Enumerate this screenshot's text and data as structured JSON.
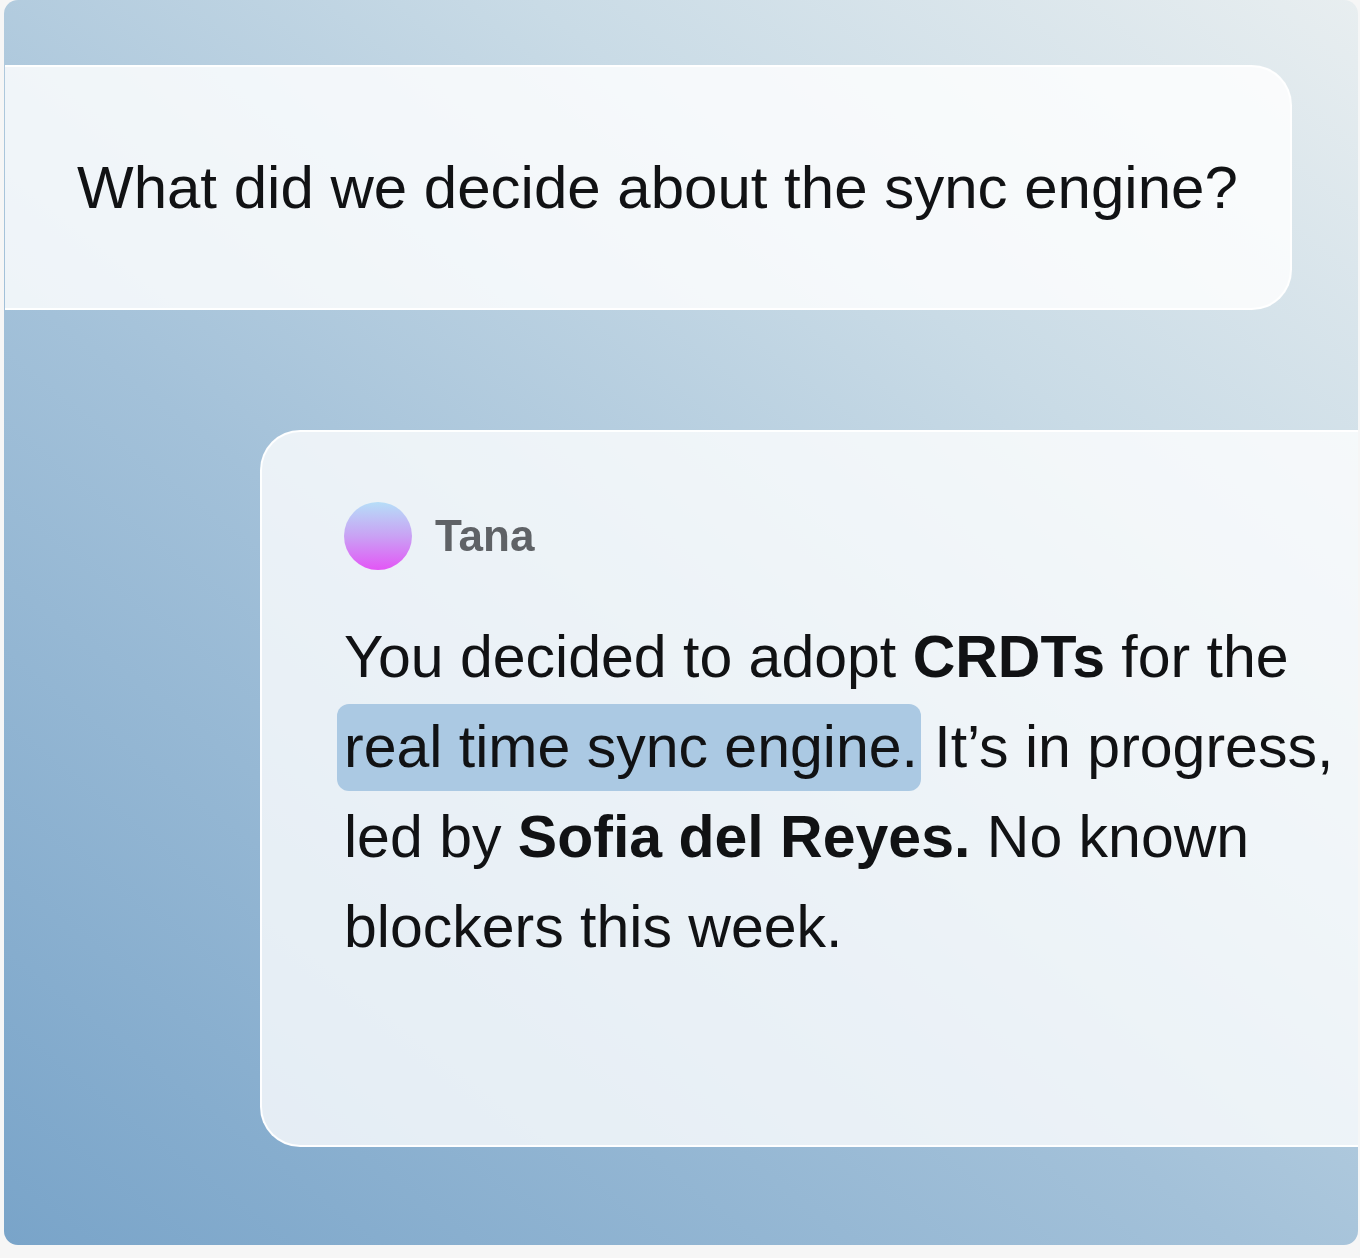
{
  "question": {
    "text": "What did we decide about the sync engine?"
  },
  "answer": {
    "sender": "Tana",
    "segments": [
      {
        "text": "You decided to adopt **CRDTs** for the ",
        "highlighted": false
      },
      {
        "text": "real time sync engine.",
        "highlighted": true
      },
      {
        "text": " It’s in progress, led by **Sofia del Reyes.** No known blockers this week.",
        "highlighted": false
      }
    ]
  }
}
